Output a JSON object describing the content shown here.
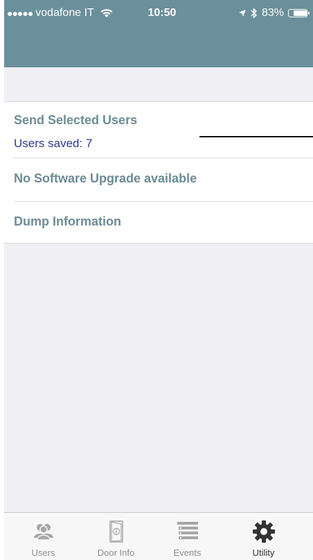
{
  "status_bar": {
    "signal": "●●●●●",
    "carrier": "vodafone IT",
    "time": "10:50",
    "battery": "83%",
    "battery_level": 0.83
  },
  "list": {
    "send_users": {
      "title": "Send Selected Users",
      "subtitle": "Users saved: 7"
    },
    "software_upgrade": {
      "title": "No Software Upgrade available"
    },
    "dump_info": {
      "title": "Dump Information"
    }
  },
  "tabs": [
    {
      "label": "Users",
      "icon": "users-icon"
    },
    {
      "label": "Door Info",
      "icon": "door-info-icon"
    },
    {
      "label": "Events",
      "icon": "events-list-icon"
    },
    {
      "label": "Utility",
      "icon": "gear-icon",
      "active": true
    }
  ],
  "colors": {
    "navbar": "#6a909b",
    "row_title": "#6d8c96",
    "subtitle": "#2d3a8c",
    "active_tab_icon": "#333333",
    "inactive_tab_icon": "#a6a6a6"
  }
}
